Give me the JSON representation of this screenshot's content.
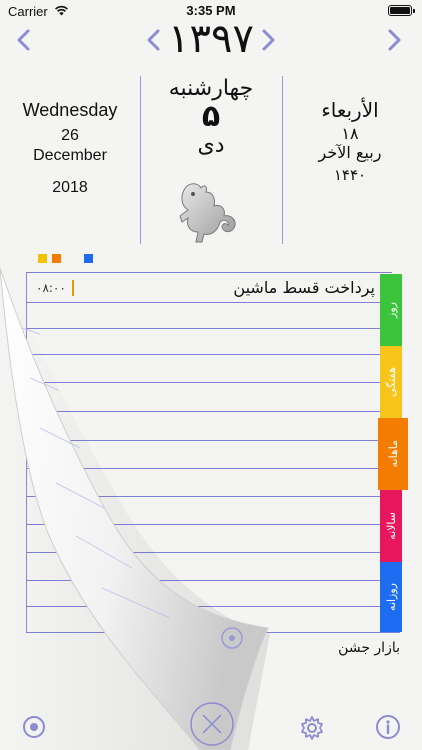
{
  "status_bar": {
    "carrier": "Carrier",
    "time": "3:35 PM"
  },
  "header": {
    "year": "۱۳۹۷",
    "prev_icon": "chevron-left-icon",
    "next_icon": "chevron-right-icon"
  },
  "date": {
    "gregorian": {
      "weekday": "Wednesday",
      "day": "26",
      "month": "December",
      "year": "2018"
    },
    "persian": {
      "weekday": "چهارشنبه",
      "day": "۵",
      "month": "دی"
    },
    "hijri": {
      "weekday": "الأربعاء",
      "day": "۱۸",
      "month": "ربیع الآخر",
      "year": "۱۴۴۰"
    },
    "zodiac_icon": "capricorn-icon"
  },
  "legend_colors": [
    "#f2c200",
    "#f47c00",
    "#1e6cf0"
  ],
  "events": [
    {
      "time": "۰۸:۰۰",
      "title": "پرداخت قسط ماشین"
    }
  ],
  "tabs": [
    {
      "label": "روز",
      "color": "#3cc43c"
    },
    {
      "label": "هفتگی",
      "color": "#f7c51a"
    },
    {
      "label": "ماهانه",
      "color": "#f47c00"
    },
    {
      "label": "سالانه",
      "color": "#e8175d"
    },
    {
      "label": "روزانه",
      "color": "#1e6cf0"
    }
  ],
  "footer_note": "بازار جشن",
  "toolbar": {
    "today_icon": "today-dot-icon",
    "add_icon": "add-note-icon",
    "settings_icon": "gear-icon",
    "info_icon": "info-icon"
  },
  "accent_color": "#8c8cd0"
}
